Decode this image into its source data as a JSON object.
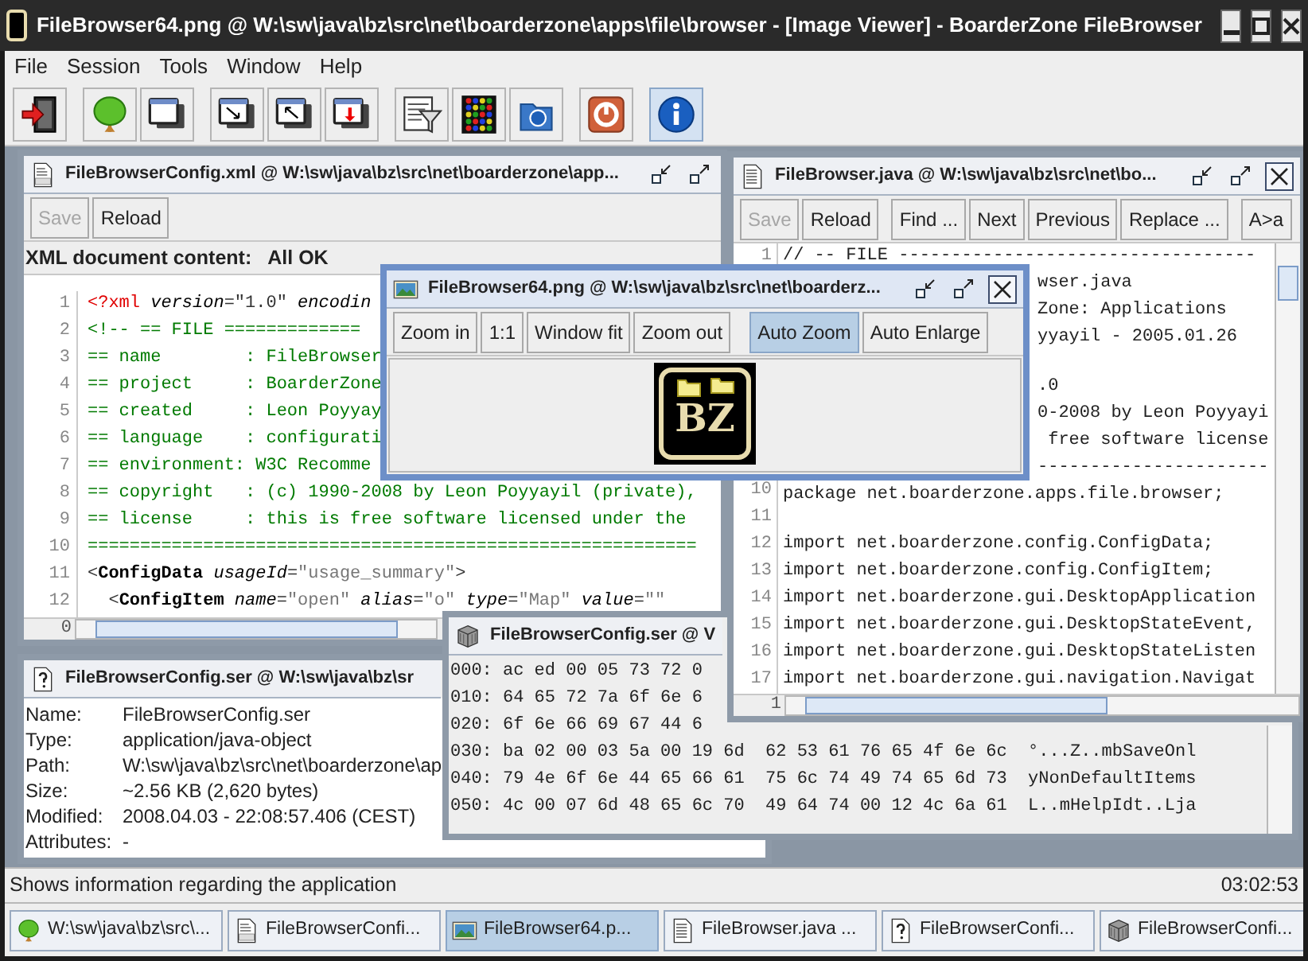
{
  "window": {
    "title": "FileBrowser64.png @ W:\\sw\\java\\bz\\src\\net\\boarderzone\\apps\\file\\browser - [Image Viewer] - BoarderZone FileBrowser"
  },
  "menu": [
    {
      "label": "File"
    },
    {
      "label": "Session"
    },
    {
      "label": "Tools"
    },
    {
      "label": "Window"
    },
    {
      "label": "Help"
    }
  ],
  "toolbar": [
    [
      {
        "kind": "exit",
        "selected": false
      }
    ],
    [
      {
        "kind": "tree",
        "selected": false
      },
      {
        "kind": "window",
        "selected": false
      }
    ],
    [
      {
        "kind": "window-down-right",
        "selected": false
      },
      {
        "kind": "window-up-left",
        "selected": false
      },
      {
        "kind": "window-down",
        "selected": false
      }
    ],
    [
      {
        "kind": "filter",
        "selected": false
      },
      {
        "kind": "color-grid",
        "selected": false
      },
      {
        "kind": "folder-info",
        "selected": false
      }
    ],
    [
      {
        "kind": "power",
        "selected": false
      }
    ],
    [
      {
        "kind": "info",
        "selected": true
      }
    ]
  ],
  "xml_editor": {
    "title": "FileBrowserConfig.xml @ W:\\sw\\java\\bz\\src\\net\\boarderzone\\app...",
    "active": false,
    "controls": [
      {
        "kind": "iconify"
      },
      {
        "kind": "maximize"
      }
    ],
    "buttons": [
      [
        {
          "label": "Save",
          "disabled": true
        },
        {
          "label": "Reload",
          "disabled": false
        }
      ]
    ],
    "status_label": "XML document content:",
    "status_value": "All OK",
    "lines": [
      {
        "num": "1",
        "segments": [
          {
            "kind": "pi",
            "text": "<?xml"
          },
          {
            "kind": "attr",
            "text": " version"
          },
          {
            "kind": "plain",
            "text": "=\"1.0\" "
          },
          {
            "kind": "attr",
            "text": "encodin"
          }
        ]
      },
      {
        "num": "2",
        "segments": [
          {
            "kind": "comment",
            "text": "<!-- == FILE ============="
          }
        ]
      },
      {
        "num": "3",
        "segments": [
          {
            "kind": "comment",
            "text": "== name        : FileBrowser"
          }
        ]
      },
      {
        "num": "4",
        "segments": [
          {
            "kind": "comment",
            "text": "== project     : BoarderZone"
          }
        ]
      },
      {
        "num": "5",
        "segments": [
          {
            "kind": "comment",
            "text": "== created     : Leon Poyyay"
          }
        ]
      },
      {
        "num": "6",
        "segments": [
          {
            "kind": "comment",
            "text": "== language    : configurati"
          }
        ]
      },
      {
        "num": "7",
        "segments": [
          {
            "kind": "comment",
            "text": "== environment: W3C Recomme"
          }
        ]
      },
      {
        "num": "8",
        "segments": [
          {
            "kind": "comment",
            "text": "== copyright   : (c) 1990-2008 by Leon Poyyayil (private),"
          }
        ]
      },
      {
        "num": "9",
        "segments": [
          {
            "kind": "comment",
            "text": "== license     : this is free software licensed under the"
          }
        ]
      },
      {
        "num": "10",
        "segments": [
          {
            "kind": "comment",
            "text": "=========================================================="
          }
        ]
      },
      {
        "num": "11",
        "segments": [
          {
            "kind": "plain",
            "text": "<"
          },
          {
            "kind": "tag",
            "text": "ConfigData"
          },
          {
            "kind": "attr",
            "text": " usageId"
          },
          {
            "kind": "plain",
            "text": "="
          },
          {
            "kind": "value",
            "text": "\"usage_summary\""
          },
          {
            "kind": "plain",
            "text": ">"
          }
        ]
      },
      {
        "num": "12",
        "segments": [
          {
            "kind": "plain",
            "text": "  <"
          },
          {
            "kind": "tag",
            "text": "ConfigItem"
          },
          {
            "kind": "attr",
            "text": " name"
          },
          {
            "kind": "plain",
            "text": "="
          },
          {
            "kind": "value",
            "text": "\"open\""
          },
          {
            "kind": "attr",
            "text": " alias"
          },
          {
            "kind": "plain",
            "text": "="
          },
          {
            "kind": "value",
            "text": "\"o\""
          },
          {
            "kind": "attr",
            "text": " type"
          },
          {
            "kind": "plain",
            "text": "="
          },
          {
            "kind": "value",
            "text": "\"Map\""
          },
          {
            "kind": "attr",
            "text": " value"
          },
          {
            "kind": "plain",
            "text": "="
          },
          {
            "kind": "value",
            "text": "\"\""
          }
        ]
      }
    ],
    "scroll_corner": "0"
  },
  "java_editor": {
    "title": "FileBrowser.java @ W:\\sw\\java\\bz\\src\\net\\bo...",
    "active": false,
    "controls": [
      {
        "kind": "iconify"
      },
      {
        "kind": "maximize"
      },
      {
        "kind": "close"
      }
    ],
    "buttons": [
      [
        {
          "label": "Save",
          "disabled": true
        },
        {
          "label": "Reload",
          "disabled": false
        }
      ],
      [
        {
          "label": "Find ...",
          "disabled": false
        },
        {
          "label": "Next",
          "disabled": false
        },
        {
          "label": "Previous",
          "disabled": false
        },
        {
          "label": "Replace ...",
          "disabled": false
        }
      ],
      [
        {
          "label": "A>a",
          "disabled": false
        }
      ]
    ],
    "lines": [
      {
        "kind": "code",
        "num": "1",
        "text": "// -- FILE ----------------------------------"
      },
      {
        "kind": "covered",
        "text": "wser.java"
      },
      {
        "kind": "covered",
        "text": "Zone: Applications"
      },
      {
        "kind": "covered",
        "text": "yyayil - 2005.01.26"
      },
      {
        "kind": "blank"
      },
      {
        "kind": "covered",
        "text": ".0"
      },
      {
        "kind": "covered",
        "text": "0-2008 by Leon Poyyayi"
      },
      {
        "kind": "covered",
        "text": " free software license"
      },
      {
        "kind": "covered",
        "text": "----------------------"
      },
      {
        "kind": "code",
        "num": "10",
        "text": "package net.boarderzone.apps.file.browser;"
      },
      {
        "kind": "blank",
        "num": "11"
      },
      {
        "kind": "code",
        "num": "12",
        "text": "import net.boarderzone.config.ConfigData;"
      },
      {
        "kind": "code",
        "num": "13",
        "text": "import net.boarderzone.config.ConfigItem;"
      },
      {
        "kind": "code",
        "num": "14",
        "text": "import net.boarderzone.gui.DesktopApplication"
      },
      {
        "kind": "code",
        "num": "15",
        "text": "import net.boarderzone.gui.DesktopStateEvent,"
      },
      {
        "kind": "code",
        "num": "16",
        "text": "import net.boarderzone.gui.DesktopStateListen"
      },
      {
        "kind": "code",
        "num": "17",
        "text": "import net.boarderzone.gui.navigation.Navigat"
      }
    ],
    "scroll_corner": "1"
  },
  "image_viewer": {
    "title": "FileBrowser64.png @ W:\\sw\\java\\bz\\src\\net\\boarderz...",
    "active": true,
    "controls": [
      {
        "kind": "iconify"
      },
      {
        "kind": "maximize"
      },
      {
        "kind": "close"
      }
    ],
    "buttons": [
      [
        {
          "label": "Zoom in",
          "selected": false
        },
        {
          "label": "1:1",
          "selected": false
        },
        {
          "label": "Window fit",
          "selected": false
        },
        {
          "label": "Zoom out",
          "selected": false
        }
      ],
      [
        {
          "label": "Auto Zoom",
          "selected": true
        },
        {
          "label": "Auto Enlarge",
          "selected": false
        }
      ]
    ],
    "image_text": "BZ"
  },
  "file_info": {
    "title": "FileBrowserConfig.ser @ W:\\sw\\java\\bz\\sr",
    "active": false,
    "rows": [
      {
        "label": "Name:",
        "value": "FileBrowserConfig.ser"
      },
      {
        "label": "Type:",
        "value": "application/java-object"
      },
      {
        "label": "Path:",
        "value": "W:\\sw\\java\\bz\\src\\net\\boarderzone\\ap"
      },
      {
        "label": "Size:",
        "value": "~2.56 KB (2,620 bytes)"
      },
      {
        "label": "Modified:",
        "value": "2008.04.03 - 22:08:57.406  (CEST)"
      },
      {
        "label": "Attributes:",
        "value": "-"
      }
    ]
  },
  "hex_viewer": {
    "title": "FileBrowserConfig.ser @ V",
    "active": false,
    "rows": [
      {
        "text": "000: ac ed 00 05 73 72 0"
      },
      {
        "text": "010: 64 65 72 7a 6f 6e 6"
      },
      {
        "text": "020: 6f 6e 66 69 67 44 6"
      },
      {
        "text": "030: ba 02 00 03 5a 00 19 6d  62 53 61 76 65 4f 6e 6c  °...Z..mbSaveOnl"
      },
      {
        "text": "040: 79 4e 6f 6e 44 65 66 61  75 6c 74 49 74 65 6d 73  yNonDefaultItems"
      },
      {
        "text": "050: 4c 00 07 6d 48 65 6c 70  49 64 74 00 12 4c 6a 61  L..mHelpIdt..Lja"
      }
    ]
  },
  "status_bar": {
    "message": "Shows information regarding the application",
    "time": "03:02:53"
  },
  "taskbar": [
    {
      "kind": "tree",
      "label": "W:\\sw\\java\\bz\\src\\...",
      "selected": false
    },
    {
      "kind": "xml-file",
      "label": "FileBrowserConfi...",
      "selected": false
    },
    {
      "kind": "image",
      "label": "FileBrowser64.p...",
      "selected": true
    },
    {
      "kind": "text-file",
      "label": "FileBrowser.java ...",
      "selected": false
    },
    {
      "kind": "question-file",
      "label": "FileBrowserConfi...",
      "selected": false
    },
    {
      "kind": "cube",
      "label": "FileBrowserConfi...",
      "selected": false
    }
  ]
}
